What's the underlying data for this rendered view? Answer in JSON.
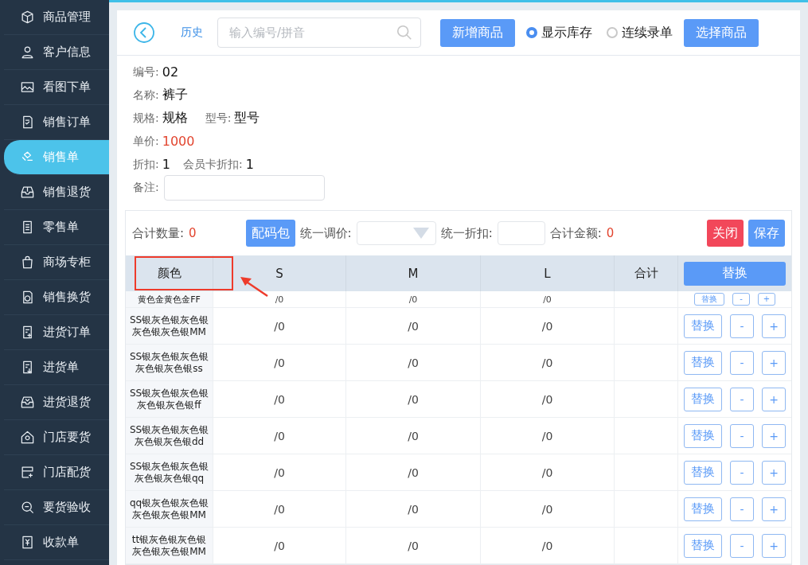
{
  "sidebar": {
    "items": [
      {
        "label": "商品管理",
        "selected": false
      },
      {
        "label": "客户信息",
        "selected": false
      },
      {
        "label": "看图下单",
        "selected": false
      },
      {
        "label": "销售订单",
        "selected": false
      },
      {
        "label": "销售单",
        "selected": true
      },
      {
        "label": "销售退货",
        "selected": false
      },
      {
        "label": "零售单",
        "selected": false
      },
      {
        "label": "商场专柜",
        "selected": false
      },
      {
        "label": "销售换货",
        "selected": false
      },
      {
        "label": "进货订单",
        "selected": false
      },
      {
        "label": "进货单",
        "selected": false
      },
      {
        "label": "进货退货",
        "selected": false
      },
      {
        "label": "门店要货",
        "selected": false
      },
      {
        "label": "门店配货",
        "selected": false
      },
      {
        "label": "要货验收",
        "selected": false
      },
      {
        "label": "收款单",
        "selected": false
      }
    ]
  },
  "toolbar": {
    "history": "历史",
    "search": {
      "placeholder": "输入编号/拼音"
    },
    "add_button": "新增商品",
    "options": [
      {
        "label": "显示库存",
        "selected": true
      },
      {
        "label": "连续录单",
        "selected": false
      }
    ],
    "select_button": "选择商品"
  },
  "product": {
    "code_label": "编号:",
    "code": "02",
    "name_label": "名称:",
    "name": "裤子",
    "spec_label": "规格:",
    "spec": "规格",
    "model_label": "型号:",
    "model": "型号",
    "price_label": "单价:",
    "price": "1000",
    "discount_label": "折扣:",
    "discount": "1",
    "card_discount_label": "会员卡折扣:",
    "card_discount": "1",
    "note_label": "备注:"
  },
  "summary": {
    "qty_label": "合计数量:",
    "qty": "0",
    "size_pack": "配码包",
    "price_label": "统一调价:",
    "discount_label": "统一折扣:",
    "amount_label": "合计金额:",
    "amount": "0",
    "close": "关闭",
    "save": "保存"
  },
  "table": {
    "columns": [
      "颜色",
      "S",
      "M",
      "L",
      "合计"
    ],
    "header_button": "替换",
    "rows": [
      {
        "name": "黄色金黄色金FF",
        "s": "/0",
        "m": "/0",
        "l": "/0",
        "replace": "替换",
        "minus": "-",
        "plus": "+"
      },
      {
        "name": "SS银灰色银灰色银灰色银灰色银MM",
        "s": "/0",
        "m": "/0",
        "l": "/0",
        "replace": "替换",
        "minus": "-",
        "plus": "+"
      },
      {
        "name": "SS银灰色银灰色银灰色银灰色银ss",
        "s": "/0",
        "m": "/0",
        "l": "/0",
        "replace": "替换",
        "minus": "-",
        "plus": "+"
      },
      {
        "name": "SS银灰色银灰色银灰色银灰色银ff",
        "s": "/0",
        "m": "/0",
        "l": "/0",
        "replace": "替换",
        "minus": "-",
        "plus": "+"
      },
      {
        "name": "SS银灰色银灰色银灰色银灰色银dd",
        "s": "/0",
        "m": "/0",
        "l": "/0",
        "replace": "替换",
        "minus": "-",
        "plus": "+"
      },
      {
        "name": "SS银灰色银灰色银灰色银灰色银qq",
        "s": "/0",
        "m": "/0",
        "l": "/0",
        "replace": "替换",
        "minus": "-",
        "plus": "+"
      },
      {
        "name": "qq银灰色银灰色银灰色银灰色银MM",
        "s": "/0",
        "m": "/0",
        "l": "/0",
        "replace": "替换",
        "minus": "-",
        "plus": "+"
      },
      {
        "name": "tt银灰色银灰色银灰色银灰色银MM",
        "s": "/0",
        "m": "/0",
        "l": "/0",
        "replace": "替换",
        "minus": "-",
        "plus": "+"
      }
    ]
  }
}
